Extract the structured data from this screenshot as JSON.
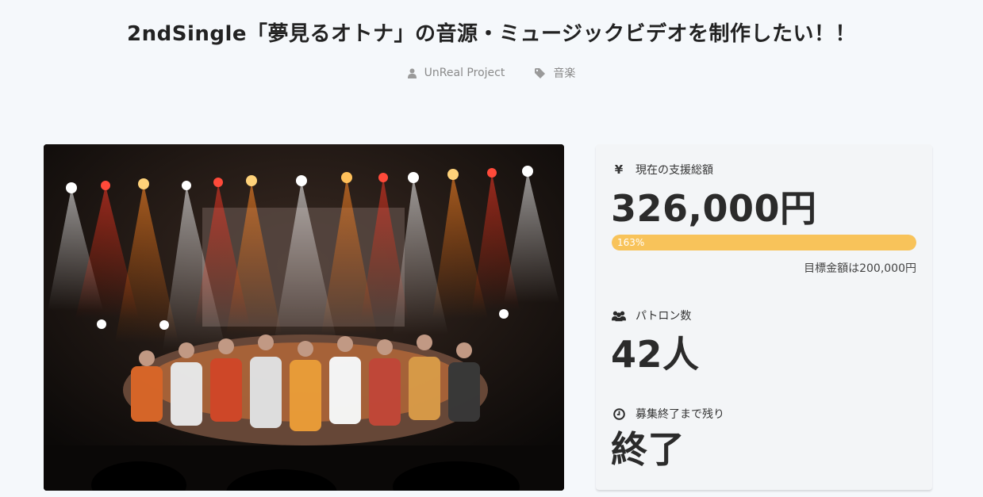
{
  "project": {
    "title": "2ndSingle「夢見るオトナ」の音源・ミュージックビデオを制作したい！！",
    "owner": "UnReal Project",
    "category": "音楽",
    "image_alt": "ステージ上の出演者たちの集合写真"
  },
  "stats": {
    "currency_symbol": "¥",
    "raised_label": "現在の支援総額",
    "raised_value": "326,000円",
    "progress_text": "163%",
    "progress_fraction": 1.0,
    "goal_text": "目標金額は200,000円",
    "patrons_label": "パトロン数",
    "patrons_value": "42人",
    "remaining_label": "募集終了まで残り",
    "remaining_value": "終了"
  },
  "colors": {
    "progress": "#f8c35a",
    "background": "#f5f8fb",
    "panel": "#f3f5f7"
  }
}
